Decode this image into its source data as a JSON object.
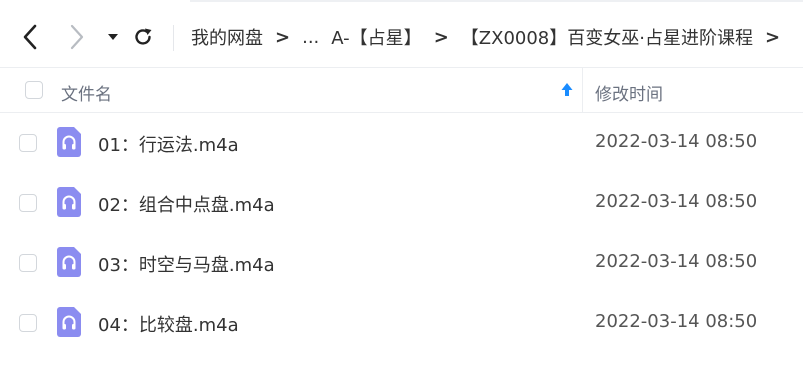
{
  "toolbar": {
    "back_icon": "chevron-left-icon",
    "forward_icon": "chevron-right-icon",
    "history_icon": "caret-down-icon",
    "refresh_icon": "refresh-icon"
  },
  "breadcrumb": {
    "root": "我的网盘",
    "ellipsis": "...",
    "parent": "A-【占星】",
    "current": "【ZX0008】百变女巫·占星进阶课程",
    "separator": ">"
  },
  "table": {
    "col_name": "文件名",
    "col_time": "修改时间",
    "sort_icon": "sort-ascending-icon",
    "accent_color": "#1a8cff",
    "file_icon_color": "#8b8cf0",
    "rows": [
      {
        "name": "01：行运法.m4a",
        "time": "2022-03-14 08:50",
        "icon": "audio-file-icon"
      },
      {
        "name": "02：组合中点盘.m4a",
        "time": "2022-03-14 08:50",
        "icon": "audio-file-icon"
      },
      {
        "name": "03：时空与马盘.m4a",
        "time": "2022-03-14 08:50",
        "icon": "audio-file-icon"
      },
      {
        "name": "04：比较盘.m4a",
        "time": "2022-03-14 08:50",
        "icon": "audio-file-icon"
      }
    ]
  }
}
